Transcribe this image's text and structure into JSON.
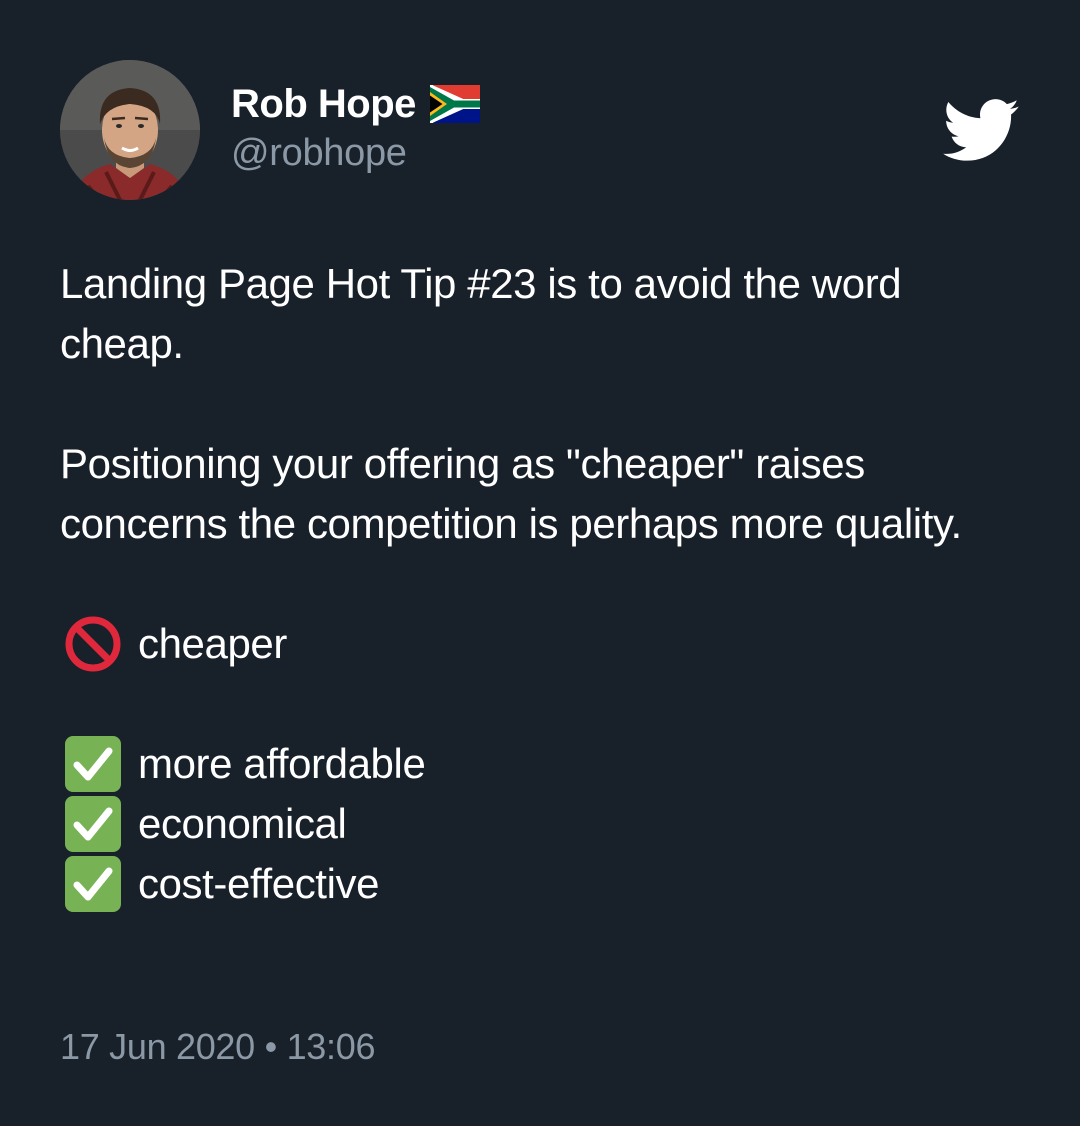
{
  "author": {
    "name": "Rob Hope",
    "handle": "@robhope",
    "flag_icon": "south-africa-flag-icon"
  },
  "tweet": {
    "line1": "Landing Page Hot Tip #23 is to avoid the word cheap.",
    "line2": "Positioning your offering as \"cheaper\" raises concerns the competition is perhaps more quality.",
    "avoid": {
      "icon": "prohibited-icon",
      "label": "cheaper"
    },
    "prefer": [
      {
        "icon": "check-mark-button-icon",
        "label": "more affordable"
      },
      {
        "icon": "check-mark-button-icon",
        "label": "economical"
      },
      {
        "icon": "check-mark-button-icon",
        "label": "cost-effective"
      }
    ]
  },
  "timestamp": "17 Jun 2020 • 13:06",
  "logo_icon": "twitter-bird-icon",
  "colors": {
    "background": "#18202a",
    "text": "#ffffff",
    "secondary_text": "#8b98a5",
    "prohibited_red": "#e0283c",
    "check_green": "#77b255"
  }
}
